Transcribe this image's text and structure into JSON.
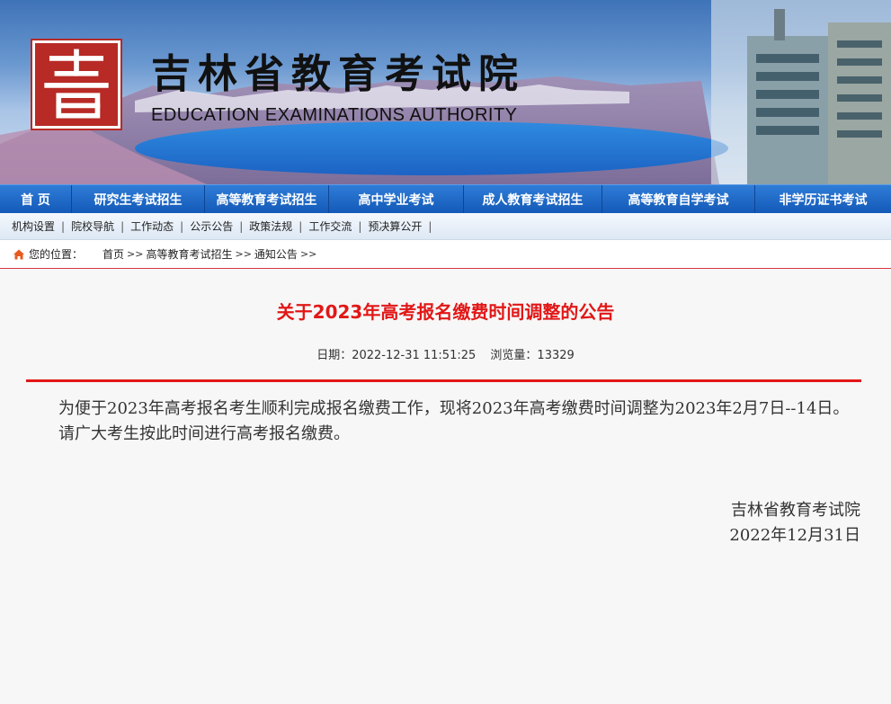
{
  "banner": {
    "title_cn": "吉林省教育考试院",
    "title_en": "EDUCATION EXAMINATIONS AUTHORITY",
    "logo_icon": "kao-seal-logo"
  },
  "main_nav": [
    {
      "label": "首 页"
    },
    {
      "label": "研究生考试招生"
    },
    {
      "label": "高等教育考试招生"
    },
    {
      "label": "高中学业考试"
    },
    {
      "label": "成人教育考试招生"
    },
    {
      "label": "高等教育自学考试"
    },
    {
      "label": "非学历证书考试"
    }
  ],
  "sub_nav": [
    {
      "label": "机构设置"
    },
    {
      "label": "院校导航"
    },
    {
      "label": "工作动态"
    },
    {
      "label": "公示公告"
    },
    {
      "label": "政策法规"
    },
    {
      "label": "工作交流"
    },
    {
      "label": "预决算公开"
    }
  ],
  "breadcrumb": {
    "prefix": "您的位置：",
    "items": [
      "首页",
      "高等教育考试招生",
      "通知公告"
    ]
  },
  "article": {
    "title": "关于2023年高考报名缴费时间调整的公告",
    "date_label": "日期：2022-12-31 11:51:25",
    "views_label": "浏览量：13329",
    "paragraphs": [
      "为便于2023年高考报名考生顺利完成报名缴费工作，现将2023年高考缴费时间调整为2023年2月7日--14日。",
      "请广大考生按此时间进行高考报名缴费。"
    ],
    "signature_org": "吉林省教育考试院",
    "signature_date": "2022年12月31日"
  },
  "colors": {
    "nav_blue": "#1459b7",
    "headline_red": "#e21717",
    "logo_red": "#b72a25"
  }
}
